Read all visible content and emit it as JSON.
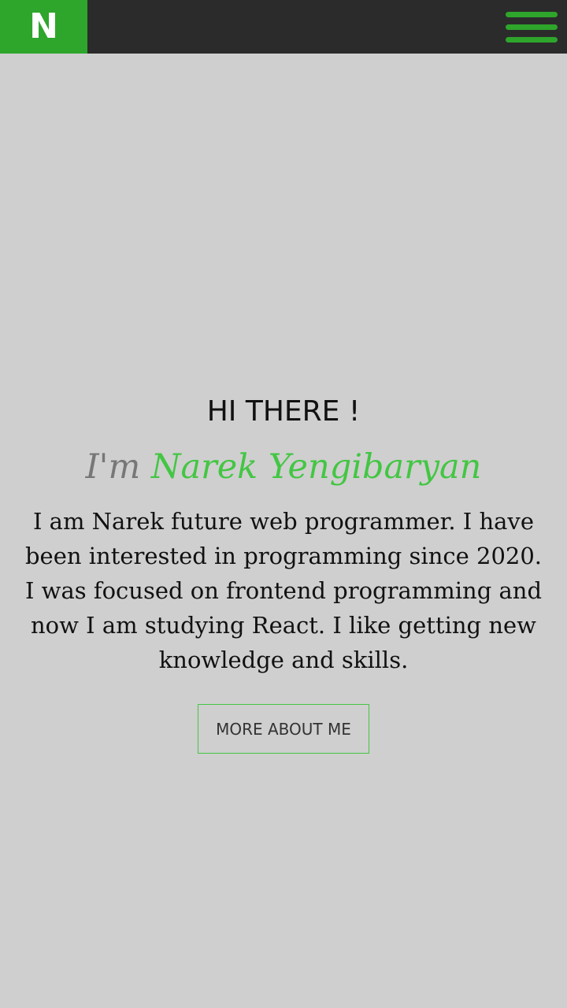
{
  "header": {
    "logo": "N",
    "menu_icon": "hamburger-menu-icon"
  },
  "hero": {
    "greeting": "HI THERE !",
    "intro_prefix": "I'm",
    "name": "Narek Yengibaryan",
    "about": "I am Narek future web programmer. I have been interested in programming since 2020. I was focused on frontend programming and now I am studying React. I like getting new knowledge and skills.",
    "button": "MORE ABOUT ME"
  },
  "colors": {
    "accent": "#43c643",
    "header_background": "#2b2b2b",
    "page_background": "#cfcfcf",
    "logo_background": "#2ea52b"
  }
}
